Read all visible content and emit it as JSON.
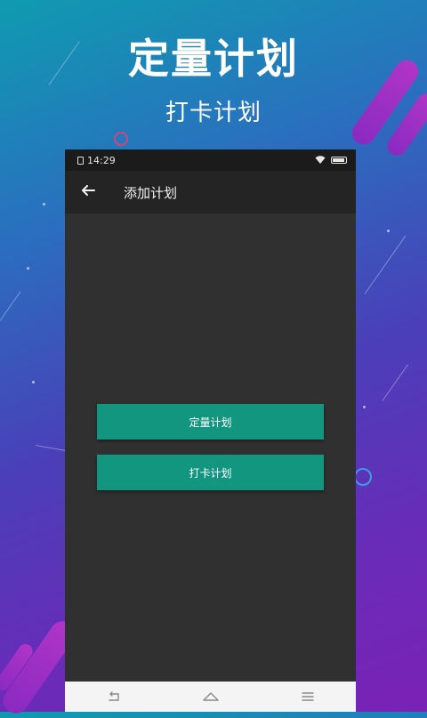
{
  "promo": {
    "title": "定量计划",
    "subtitle": "打卡计划"
  },
  "status_bar": {
    "time": "14:29"
  },
  "app_bar": {
    "title": "添加计划",
    "back_icon": "arrow-left-icon"
  },
  "plan_options": [
    {
      "label": "定量计划"
    },
    {
      "label": "打卡计划"
    }
  ],
  "nav_bar": {
    "icons": [
      "back-nav-icon",
      "home-nav-icon",
      "menu-nav-icon"
    ]
  },
  "colors": {
    "accent": "#139680",
    "screen_background": "#303030",
    "app_bar": "#242424"
  }
}
